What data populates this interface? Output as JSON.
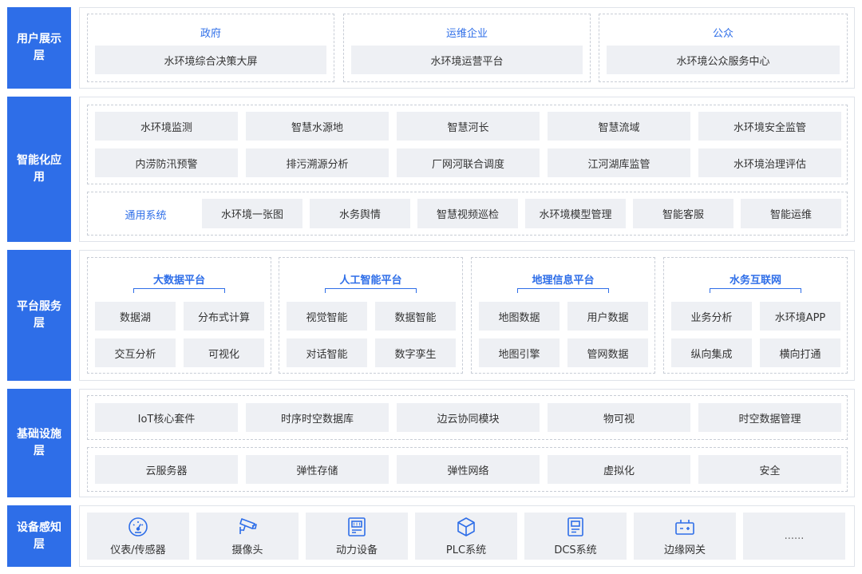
{
  "layers": {
    "user": {
      "label": "用户展示层",
      "groups": [
        {
          "title": "政府",
          "item": "水环境综合决策大屏"
        },
        {
          "title": "运维企业",
          "item": "水环境运营平台"
        },
        {
          "title": "公众",
          "item": "水环境公众服务中心"
        }
      ]
    },
    "app": {
      "label": "智能化应用",
      "row1": [
        "水环境监测",
        "智慧水源地",
        "智慧河长",
        "智慧流域",
        "水环境安全监管"
      ],
      "row2": [
        "内涝防汛预警",
        "排污溯源分析",
        "厂网河联合调度",
        "江河湖库监管",
        "水环境治理评估"
      ],
      "general_title": "通用系统",
      "general": [
        "水环境一张图",
        "水务舆情",
        "智慧视频巡检",
        "水环境模型管理",
        "智能客服",
        "智能运维"
      ]
    },
    "platform": {
      "label": "平台服务层",
      "groups": [
        {
          "title": "大数据平台",
          "items": [
            "数据湖",
            "分布式计算",
            "交互分析",
            "可视化"
          ]
        },
        {
          "title": "人工智能平台",
          "items": [
            "视觉智能",
            "数据智能",
            "对话智能",
            "数字孪生"
          ]
        },
        {
          "title": "地理信息平台",
          "items": [
            "地图数据",
            "用户数据",
            "地图引擎",
            "管网数据"
          ]
        },
        {
          "title": "水务互联网",
          "items": [
            "业务分析",
            "水环境APP",
            "纵向集成",
            "横向打通"
          ]
        }
      ]
    },
    "infra": {
      "label": "基础设施层",
      "row1": [
        "IoT核心套件",
        "时序时空数据库",
        "边云协同模块",
        "物可视",
        "时空数据管理"
      ],
      "row2": [
        "云服务器",
        "弹性存储",
        "弹性网络",
        "虚拟化",
        "安全"
      ]
    },
    "device": {
      "label": "设备感知层",
      "items": [
        {
          "name": "仪表/传感器",
          "icon": "gauge-icon"
        },
        {
          "name": "摄像头",
          "icon": "camera-icon"
        },
        {
          "name": "动力设备",
          "icon": "power-cabinet-icon"
        },
        {
          "name": "PLC系统",
          "icon": "cube-icon"
        },
        {
          "name": "DCS系统",
          "icon": "control-panel-icon"
        },
        {
          "name": "边缘网关",
          "icon": "gateway-icon"
        },
        {
          "name": "......",
          "icon": ""
        }
      ]
    }
  },
  "colors": {
    "accent": "#2e6ee8",
    "box": "#eef0f4",
    "border": "#dfe3ea",
    "dash": "#c8cdd6"
  }
}
